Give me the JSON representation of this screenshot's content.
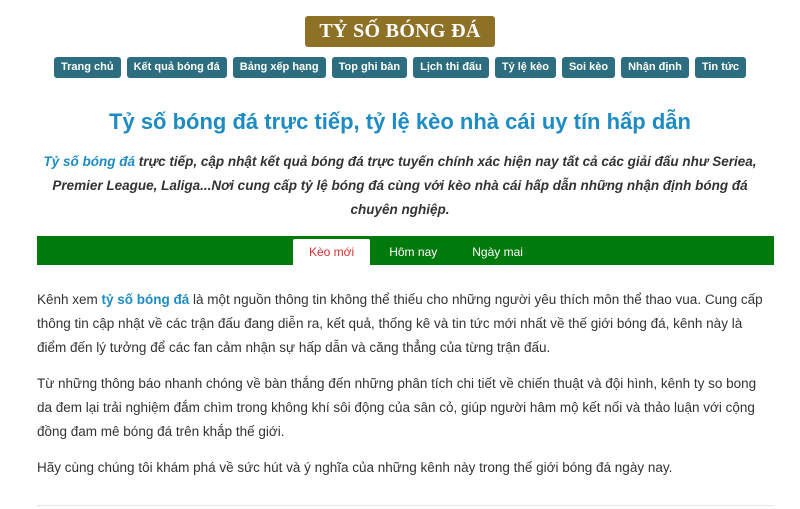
{
  "logo": {
    "text": "TỶ SỐ BÓNG ĐÁ"
  },
  "nav": {
    "items": [
      {
        "label": "Trang chủ"
      },
      {
        "label": "Kết quả bóng đá"
      },
      {
        "label": "Bảng xếp hạng"
      },
      {
        "label": "Top ghi bàn"
      },
      {
        "label": "Lịch thi đấu"
      },
      {
        "label": "Tỷ lệ kèo"
      },
      {
        "label": "Soi kèo"
      },
      {
        "label": "Nhận định"
      },
      {
        "label": "Tin tức"
      }
    ]
  },
  "headline": "Tỷ số bóng đá trực tiếp, tỷ lệ kèo nhà cái uy tín hấp dẫn",
  "intro": {
    "link_text": "Tỷ số bóng đá",
    "text": " trực tiếp, cập nhật kết quả bóng đá trực tuyến chính xác hiện nay tất cả các giải đấu như Seriea, Premier League, Laliga...Nơi cung cấp tỷ lệ bóng đá cùng với kèo nhà cái hấp dẫn những nhận định bóng đá chuyên nghiệp."
  },
  "tabs": [
    {
      "label": "Kèo mới",
      "active": true
    },
    {
      "label": "Hôm nay",
      "active": false
    },
    {
      "label": "Ngày mai",
      "active": false
    }
  ],
  "colors": {
    "logo_bg": "#8c7127",
    "nav_bg": "#2c6e7f",
    "headline": "#1e8bc3",
    "tabbar_bg": "#007a0a",
    "active_tab_text": "#d32f2f"
  },
  "body": {
    "p1_before": "Kênh xem ",
    "p1_link": "tỷ số bóng đá",
    "p1_after": " là một nguồn thông tin không thể thiếu cho những người yêu thích môn thể thao vua. Cung cấp thông tin cập nhật về các trận đấu đang diễn ra, kết quả, thống kê và tin tức mới nhất về thế giới bóng đá, kênh này là điểm đến lý tưởng để các fan cảm nhận sự hấp dẫn và căng thẳng của từng trận đấu.",
    "p2": "Từ những thông báo nhanh chóng về bàn thắng đến những phân tích chi tiết về chiến thuật và đội hình, kênh ty so bong da đem lại trải nghiệm đắm chìm trong không khí sôi động của sân cỏ, giúp người hâm mộ kết nối và thảo luận với cộng đồng đam mê bóng đá trên khắp thế giới.",
    "p3": "Hãy cùng chúng tôi khám phá về sức hút và ý nghĩa của những kênh này trong thế giới bóng đá ngày nay."
  }
}
